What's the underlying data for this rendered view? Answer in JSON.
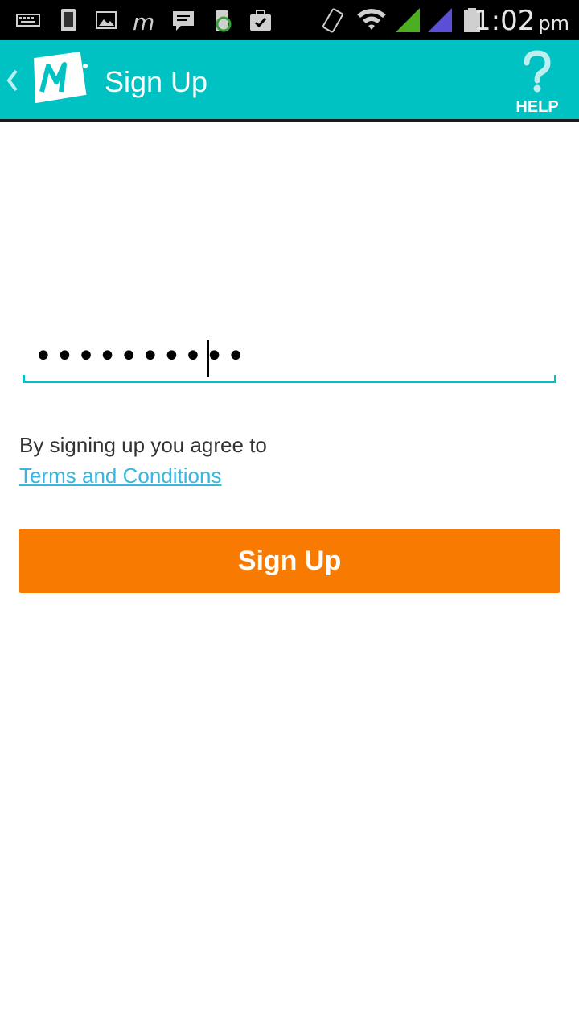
{
  "status_bar": {
    "time": "1:02",
    "ampm": "pm",
    "icons": [
      "keyboard-icon",
      "phone-icon",
      "image-icon",
      "m-app-icon",
      "chat-icon",
      "battery-saver-icon",
      "briefcase-icon",
      "vibrate-icon",
      "wifi-icon",
      "signal-icon",
      "signal-icon-2",
      "battery-icon"
    ]
  },
  "app_bar": {
    "title": "Sign Up",
    "help_label": "HELP",
    "accent": "#00c2c2"
  },
  "form": {
    "password_value": "••••••••••",
    "agree_text": "By signing up you agree to",
    "terms_link": "Terms and Conditions",
    "submit_label": "Sign Up",
    "submit_color": "#f97a00"
  }
}
